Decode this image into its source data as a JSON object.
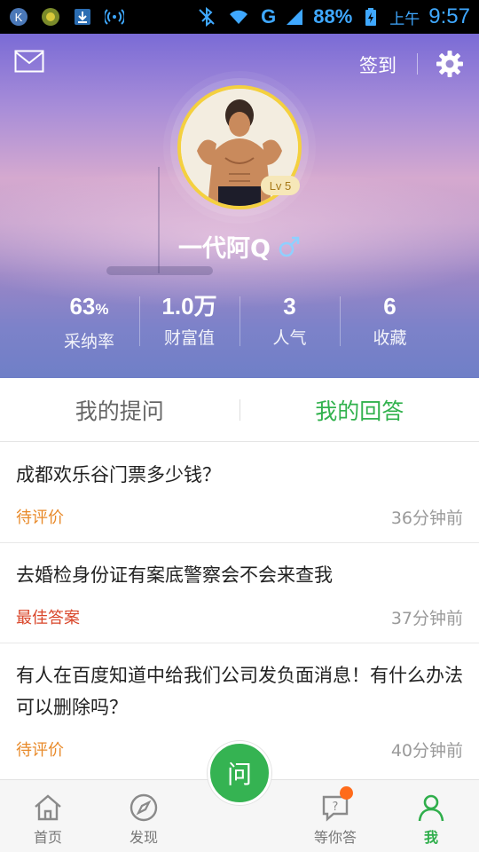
{
  "status_bar": {
    "battery": "88%",
    "network": "G",
    "ampm": "上午",
    "time": "9:57"
  },
  "header": {
    "checkin_label": "签到",
    "level_badge": "Lv 5",
    "username": "一代阿Q",
    "stats": [
      {
        "value": "63",
        "unit": "%",
        "label": "采纳率"
      },
      {
        "value": "1.0万",
        "unit": "",
        "label": "财富值"
      },
      {
        "value": "3",
        "unit": "",
        "label": "人气"
      },
      {
        "value": "6",
        "unit": "",
        "label": "收藏"
      }
    ]
  },
  "tabs": [
    {
      "label": "我的提问",
      "active": false
    },
    {
      "label": "我的回答",
      "active": true
    }
  ],
  "questions": [
    {
      "title": "成都欢乐谷门票多少钱？",
      "status": "待评价",
      "time": "36分钟前"
    },
    {
      "title": "去婚检身份证有案底警察会不会来查我",
      "status": "最佳答案",
      "time": "37分钟前"
    },
    {
      "title": "有人在百度知道中给我们公司发负面消息！有什么办法可以删除吗？",
      "status": "待评价",
      "time": "40分钟前"
    }
  ],
  "bottom_nav": {
    "ask_label": "问",
    "items": [
      {
        "label": "首页"
      },
      {
        "label": "发现"
      },
      {
        "label": "等你答"
      },
      {
        "label": "我"
      }
    ]
  },
  "colors": {
    "accent_green": "#32b24e",
    "pending_orange": "#e88a2a",
    "best_red": "#d9462a",
    "notif_orange": "#ff6b1a"
  }
}
